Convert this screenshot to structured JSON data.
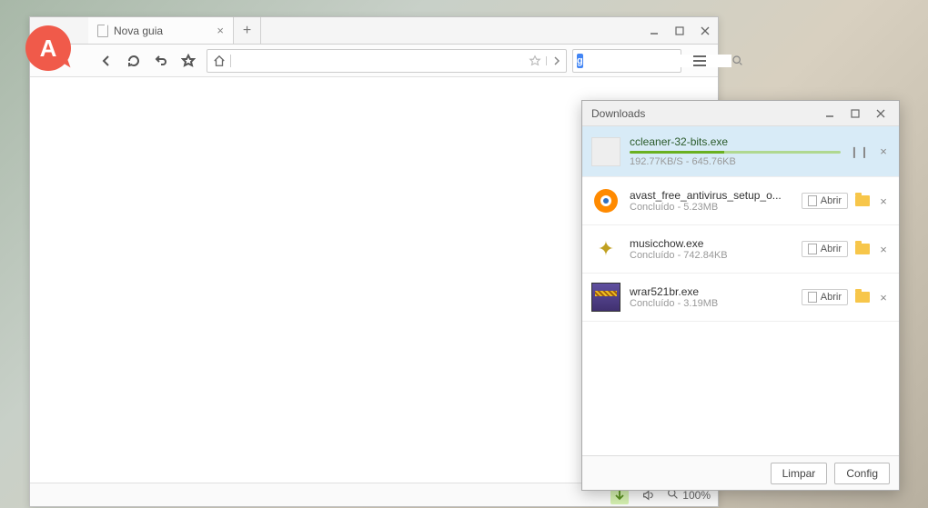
{
  "browser": {
    "logo_letter": "A",
    "tab": {
      "title": "Nova guia"
    },
    "address": {
      "placeholder": ""
    },
    "search": {
      "provider_letter": "g",
      "placeholder": ""
    },
    "status": {
      "zoom": "100%"
    }
  },
  "downloads": {
    "title": "Downloads",
    "items": [
      {
        "name": "ccleaner-32-bits.exe",
        "sub": "192.77KB/S - 645.76KB",
        "active": true
      },
      {
        "name": "avast_free_antivirus_setup_o...",
        "sub": "Concluído - 5.23MB",
        "open_label": "Abrir"
      },
      {
        "name": "musicchow.exe",
        "sub": "Concluído - 742.84KB",
        "open_label": "Abrir"
      },
      {
        "name": "wrar521br.exe",
        "sub": "Concluído - 3.19MB",
        "open_label": "Abrir"
      }
    ],
    "buttons": {
      "clear": "Limpar",
      "config": "Config"
    }
  }
}
